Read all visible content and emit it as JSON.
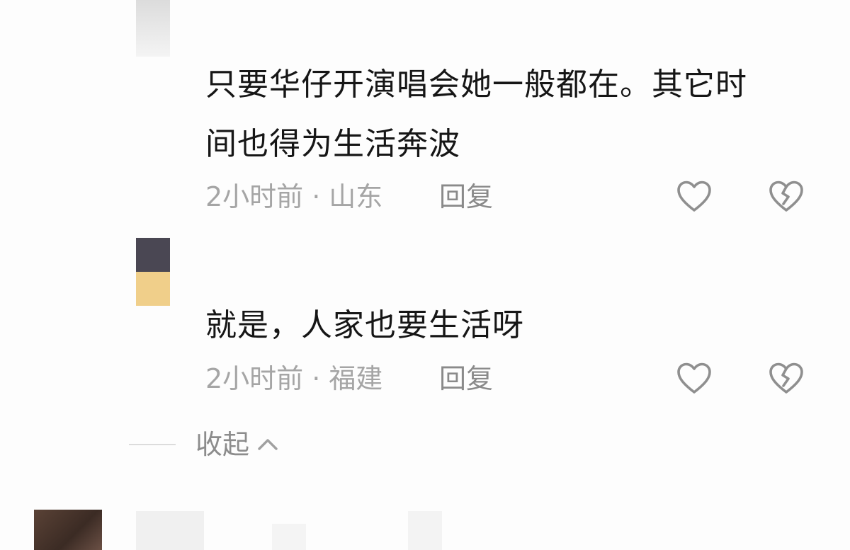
{
  "comments": [
    {
      "text_line1": "只要华仔开演唱会她一般都在。其它时",
      "text_line2": "间也得为生活奔波",
      "time": "2小时前",
      "separator": "·",
      "location": "山东",
      "reply_label": "回复",
      "like_icon": "heart-outline-icon",
      "dislike_icon": "broken-heart-icon"
    },
    {
      "text_line1": "就是，人家也要生活呀",
      "time": "2小时前",
      "separator": "·",
      "location": "福建",
      "reply_label": "回复",
      "like_icon": "heart-outline-icon",
      "dislike_icon": "broken-heart-icon"
    }
  ],
  "collapse": {
    "label": "收起",
    "icon": "chevron-up-icon"
  },
  "colors": {
    "text": "#161616",
    "meta": "#a5a5a5",
    "icon": "#8f8f8f"
  }
}
